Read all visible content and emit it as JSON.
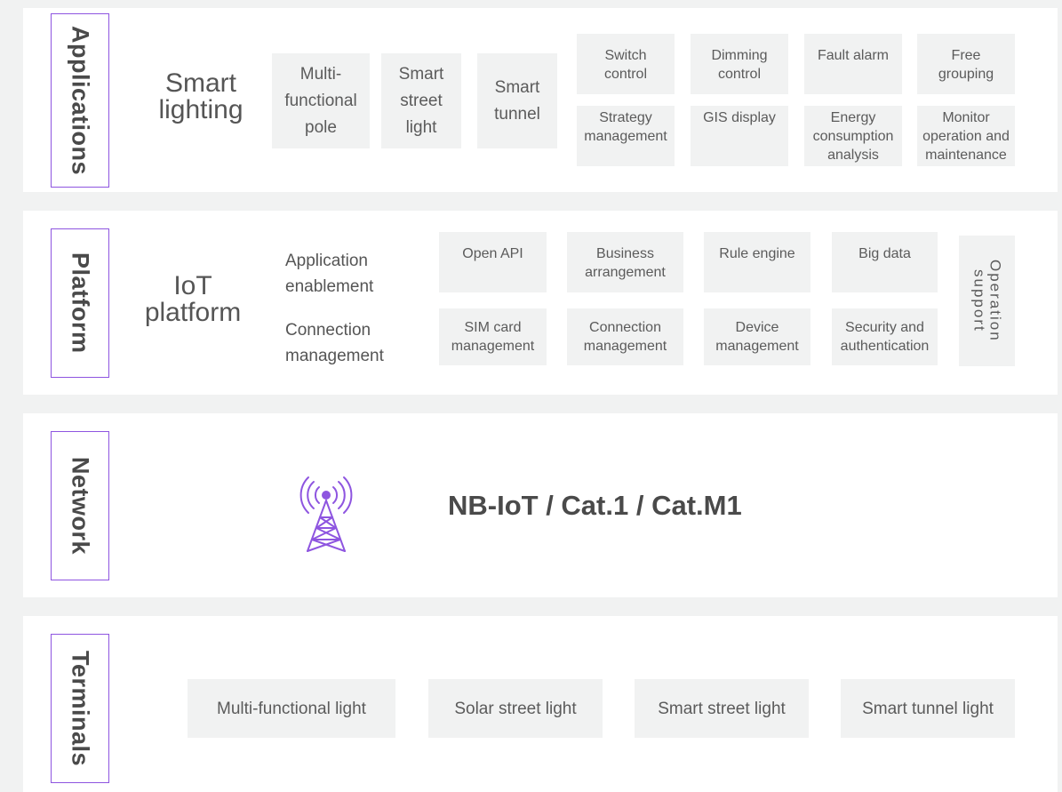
{
  "colors": {
    "accent": "#8e55e0",
    "band_bg": "#ffffff",
    "page_bg": "#f1f2f2",
    "box_bg": "#f1f2f2"
  },
  "applications": {
    "tag": "Applications",
    "heading": "Smart\nlighting",
    "modules": [
      "Multi-\nfunctional\npole",
      "Smart\nstreet\nlight",
      "Smart\ntunnel"
    ],
    "functions": [
      "Switch\ncontrol",
      "Dimming\ncontrol",
      "Fault alarm",
      "Free\ngrouping",
      "Strategy\nmanagement",
      "GIS display",
      "Energy\nconsumption\nanalysis",
      "Monitor\noperation and\nmaintenance"
    ]
  },
  "platform": {
    "tag": "Platform",
    "heading": "IoT\nplatform",
    "row_labels": [
      "Application\nenablement",
      "Connection\nmanagement"
    ],
    "enablement": [
      "Open API",
      "Business\narrangement",
      "Rule engine",
      "Big data"
    ],
    "connection": [
      "SIM card\nmanagement",
      "Connection\nmanagement",
      "Device\nmanagement",
      "Security and\nauthentication"
    ],
    "side_box": "Operation\nsupport"
  },
  "network": {
    "tag": "Network",
    "icon": "cell-tower-icon",
    "label": "NB-IoT / Cat.1 / Cat.M1"
  },
  "terminals": {
    "tag": "Terminals",
    "items": [
      "Multi-functional light",
      "Solar street light",
      "Smart street light",
      "Smart tunnel light"
    ]
  }
}
